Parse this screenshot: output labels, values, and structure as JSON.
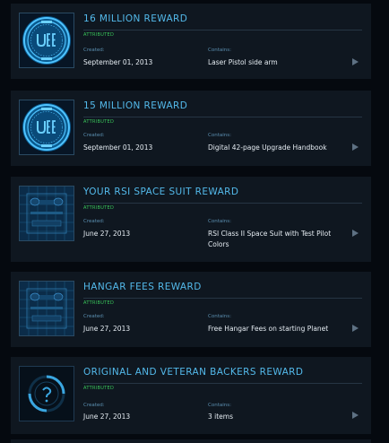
{
  "rewards": [
    {
      "title": "16 MILLION REWARD",
      "status": "ATTRIBUTED",
      "created_label": "Created:",
      "created": "September 01, 2013",
      "contains_label": "Contains:",
      "contains": "Laser Pistol side arm",
      "icon": "uee-emblem-icon"
    },
    {
      "title": "15 MILLION REWARD",
      "status": "ATTRIBUTED",
      "created_label": "Created:",
      "created": "September 01, 2013",
      "contains_label": "Contains:",
      "contains": "Digital 42-page Upgrade Handbook",
      "icon": "uee-emblem-icon"
    },
    {
      "title": "YOUR RSI SPACE SUIT REWARD",
      "status": "ATTRIBUTED",
      "created_label": "Created:",
      "created": "June 27, 2013",
      "contains_label": "Contains:",
      "contains": "RSI Class II Space Suit with Test Pilot Colors",
      "icon": "blueprint-icon"
    },
    {
      "title": "HANGAR FEES REWARD",
      "status": "ATTRIBUTED",
      "created_label": "Created:",
      "created": "June 27, 2013",
      "contains_label": "Contains:",
      "contains": "Free Hangar Fees on starting Planet",
      "icon": "blueprint-icon"
    },
    {
      "title": "ORIGINAL AND VETERAN BACKERS REWARD",
      "status": "ATTRIBUTED",
      "created_label": "Created:",
      "created": "June 27, 2013",
      "contains_label": "Contains:",
      "contains": "3 items",
      "icon": "mystery-item-icon"
    }
  ],
  "colors": {
    "title": "#53b9ea",
    "attributed": "#39c65a",
    "label": "#5b8fb0",
    "value": "#e5ecf2",
    "card_bg": "#0f1720",
    "page_bg": "#05090f"
  }
}
